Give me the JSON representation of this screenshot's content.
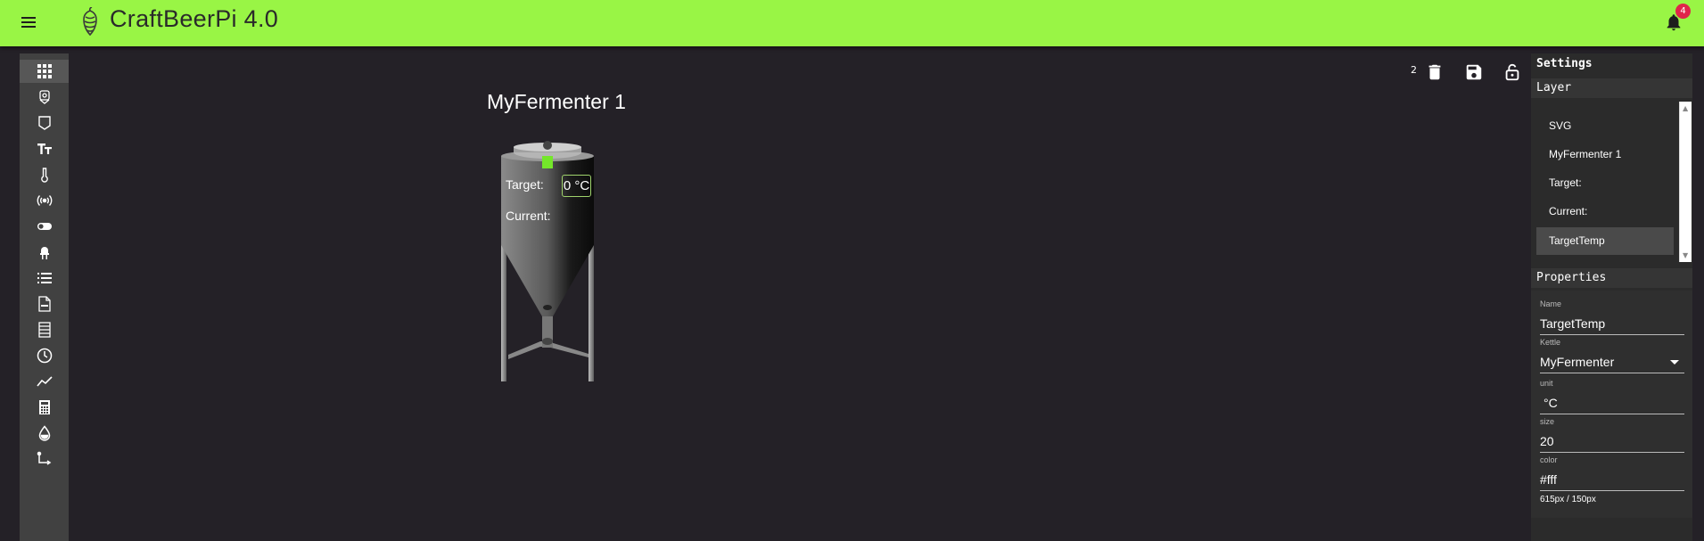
{
  "app": {
    "title": "CraftBeerPi 4.0",
    "notification_count": "4",
    "accent_color": "#99f545",
    "badge_color": "#e0254a"
  },
  "toolbar": {
    "items": [
      {
        "icon": "apps-grid-icon"
      },
      {
        "icon": "fermenter-icon"
      },
      {
        "icon": "kettle-icon"
      },
      {
        "icon": "text-icon"
      },
      {
        "icon": "thermometer-icon"
      },
      {
        "icon": "broadcast-icon"
      },
      {
        "icon": "toggle-icon"
      },
      {
        "icon": "led-icon"
      },
      {
        "icon": "list-icon"
      },
      {
        "icon": "svg-file-icon"
      },
      {
        "icon": "table-icon"
      },
      {
        "icon": "clock-icon"
      },
      {
        "icon": "chart-line-icon"
      },
      {
        "icon": "calculator-icon"
      },
      {
        "icon": "water-drop-icon"
      },
      {
        "icon": "path-icon"
      }
    ]
  },
  "canvas": {
    "title": "MyFermenter 1",
    "selection_count": "2",
    "target_label": "Target:",
    "current_label": "Current:",
    "target_value": "0 °C"
  },
  "settings": {
    "title": "Settings",
    "layer_heading": "Layer",
    "layers": [
      "SVG",
      "MyFermenter 1",
      "Target:",
      "Current:",
      "TargetTemp"
    ],
    "selected_layer": "TargetTemp",
    "properties_heading": "Properties",
    "fields": {
      "name_label": "Name",
      "name_value": "TargetTemp",
      "kettle_label": "Kettle",
      "kettle_value": "MyFermenter",
      "unit_label": "unit",
      "unit_value": "°C",
      "size_label": "size",
      "size_value": "20",
      "color_label": "color",
      "color_value": "#fff"
    },
    "size_note": "615px / 150px"
  }
}
